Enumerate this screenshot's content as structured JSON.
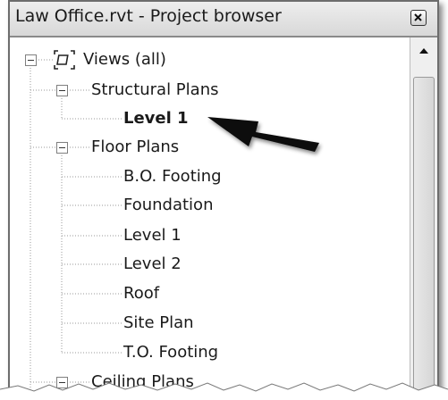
{
  "window": {
    "title": "Law Office.rvt - Project browser"
  },
  "tree": {
    "root": {
      "label": "Views (all)",
      "icon": "views-icon"
    },
    "structural_plans": {
      "label": "Structural Plans",
      "items": [
        "Level 1"
      ]
    },
    "floor_plans": {
      "label": "Floor Plans",
      "items": [
        "B.O. Footing",
        "Foundation",
        "Level 1",
        "Level 2",
        "Roof",
        "Site Plan",
        "T.O. Footing"
      ]
    },
    "ceiling_plans": {
      "label": "Ceiling Plans"
    }
  },
  "annotation": {
    "arrow": "pointer-arrow",
    "selected_item": "Level 1"
  },
  "colors": {
    "panel_border": "#6d6d6d",
    "titlebar": "#d8d8d8",
    "background": "#ffffff",
    "text": "#1a1a1a"
  }
}
